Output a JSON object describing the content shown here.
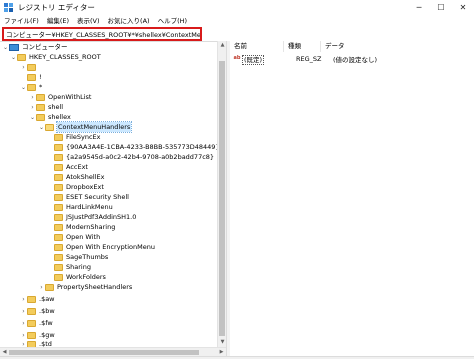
{
  "window": {
    "title": "レジストリ エディター",
    "minimize_glyph": "─",
    "maximize_glyph": "☐",
    "close_glyph": "✕"
  },
  "menu": [
    "ファイル(F)",
    "編集(E)",
    "表示(V)",
    "お気に入り(A)",
    "ヘルプ(H)"
  ],
  "address": "コンピューター¥HKEY_CLASSES_ROOT¥*¥shellex¥ContextMenuHandlers",
  "tree": [
    {
      "label": "コンピューター",
      "chevron": "⌄",
      "icon": "computer-icon"
    },
    {
      "label": "HKEY_CLASSES_ROOT",
      "chevron": "⌄",
      "icon": "folder-icon"
    },
    {
      "label": "",
      "chevron": "›",
      "icon": "folder-icon"
    },
    {
      "label": "!",
      "chevron": "",
      "icon": "folder-icon"
    },
    {
      "label": "*",
      "chevron": "⌄",
      "icon": "folder-icon"
    },
    {
      "label": "OpenWithList",
      "chevron": "›",
      "icon": "folder-icon"
    },
    {
      "label": "shell",
      "chevron": "›",
      "icon": "folder-icon"
    },
    {
      "label": "shellex",
      "chevron": "⌄",
      "icon": "folder-icon"
    },
    {
      "label": "ContextMenuHandlers",
      "chevron": "⌄",
      "icon": "folder-open-icon",
      "selected": true
    },
    {
      "label": "FileSyncEx",
      "chevron": "",
      "icon": "folder-icon"
    },
    {
      "label": "{90AA3A4E-1CBA-4233-B8BB-535773D48449}",
      "chevron": "",
      "icon": "folder-icon"
    },
    {
      "label": "{a2a9545d-a0c2-42b4-9708-a0b2badd77c8}",
      "chevron": "",
      "icon": "folder-icon"
    },
    {
      "label": "AccExt",
      "chevron": "",
      "icon": "folder-icon"
    },
    {
      "label": "AtokShellEx",
      "chevron": "",
      "icon": "folder-icon"
    },
    {
      "label": "DropboxExt",
      "chevron": "",
      "icon": "folder-icon"
    },
    {
      "label": "ESET Security Shell",
      "chevron": "",
      "icon": "folder-icon"
    },
    {
      "label": "HardLinkMenu",
      "chevron": "",
      "icon": "folder-icon"
    },
    {
      "label": "JSJustPdf3AddinSH1.0",
      "chevron": "",
      "icon": "folder-icon"
    },
    {
      "label": "ModernSharing",
      "chevron": "",
      "icon": "folder-icon"
    },
    {
      "label": "Open With",
      "chevron": "",
      "icon": "folder-icon"
    },
    {
      "label": "Open With EncryptionMenu",
      "chevron": "",
      "icon": "folder-icon"
    },
    {
      "label": "SageThumbs",
      "chevron": "",
      "icon": "folder-icon"
    },
    {
      "label": "Sharing",
      "chevron": "",
      "icon": "folder-icon"
    },
    {
      "label": "WorkFolders",
      "chevron": "",
      "icon": "folder-icon"
    },
    {
      "label": "PropertySheetHandlers",
      "chevron": "›",
      "icon": "folder-icon"
    },
    {
      "label": ".$aw",
      "chevron": "›",
      "icon": "folder-icon"
    },
    {
      "label": ".$bw",
      "chevron": "›",
      "icon": "folder-icon"
    },
    {
      "label": ".$fw",
      "chevron": "›",
      "icon": "folder-icon"
    },
    {
      "label": ".$gw",
      "chevron": "›",
      "icon": "folder-icon"
    },
    {
      "label": ".$td",
      "chevron": "›",
      "icon": "folder-icon"
    }
  ],
  "list": {
    "headers": [
      "名前",
      "種類",
      "データ"
    ],
    "rows": [
      {
        "icon": "ab",
        "name": "(既定)",
        "type": "REG_SZ",
        "data": "(値の設定なし)"
      }
    ]
  },
  "scroll": {
    "up": "▲",
    "down": "▼",
    "left": "◀",
    "right": "▶"
  }
}
